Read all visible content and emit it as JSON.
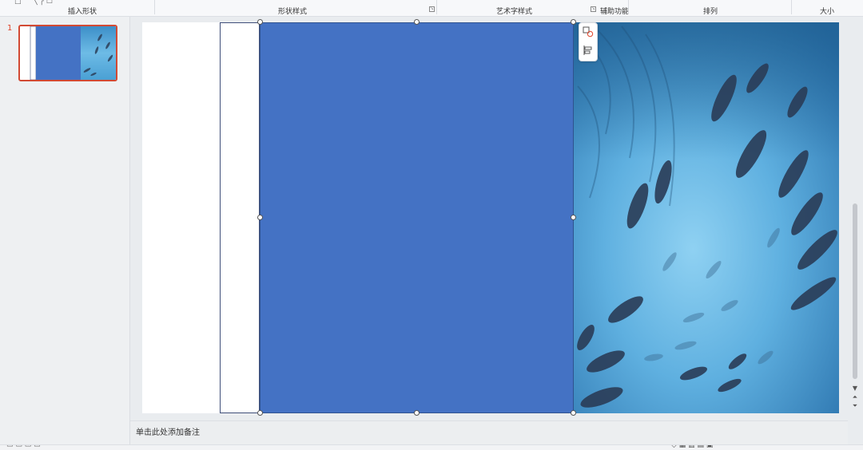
{
  "ribbon": {
    "groups": {
      "insert_shape": "插入形状",
      "shape_style": "形状样式",
      "art_text_style": "艺术字样式",
      "assist": "辅助功能",
      "arrange": "排列",
      "size": "大小"
    }
  },
  "slides": {
    "current_number": "1"
  },
  "notes": {
    "placeholder": "单击此处添加备注"
  },
  "colors": {
    "shape_fill": "#4472c4",
    "thumb_border": "#d24a34",
    "ocean_light": "#5fb0e0",
    "ocean_dark": "#1e5d8f"
  },
  "icons": [
    "shape-merge-icon",
    "align-icon",
    "scroll-up-icon",
    "scroll-down-icon",
    "prev-slide-icon",
    "next-slide-icon"
  ]
}
